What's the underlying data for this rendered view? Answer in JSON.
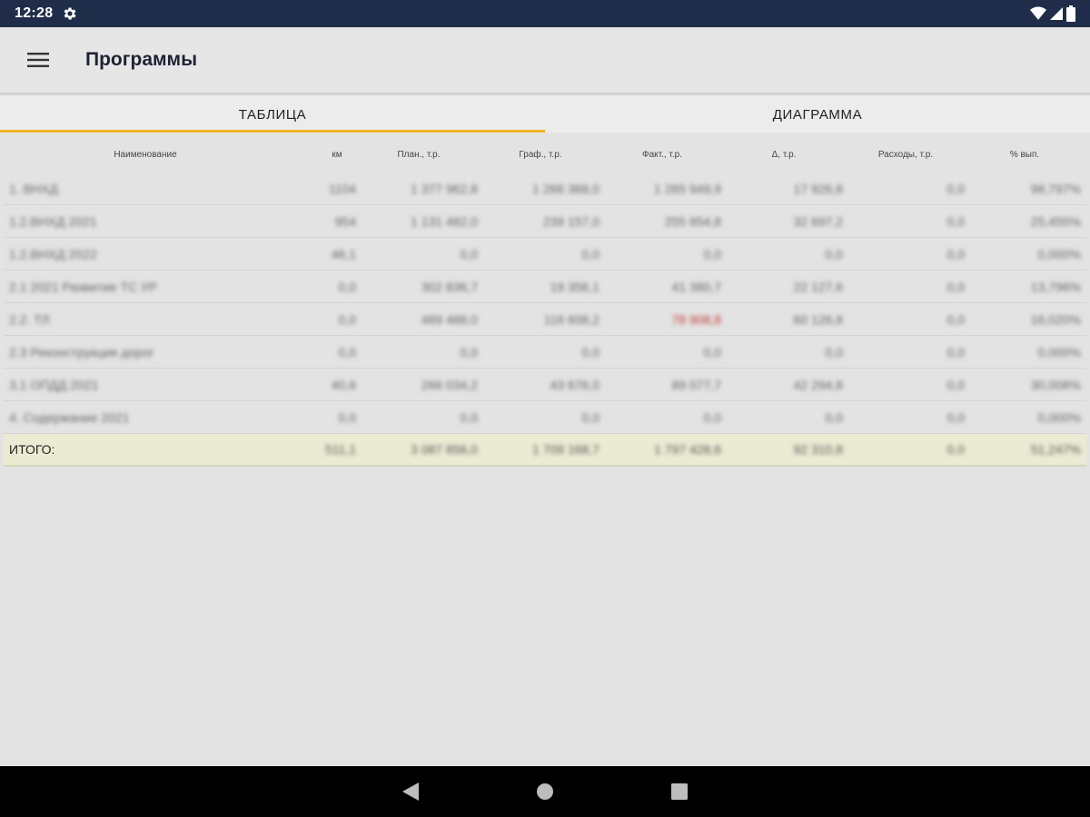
{
  "status_bar": {
    "time": "12:28"
  },
  "app_bar": {
    "title": "Программы"
  },
  "tabs": [
    {
      "label": "ТАБЛИЦА",
      "active": true
    },
    {
      "label": "ДИАГРАММА",
      "active": false
    }
  ],
  "table": {
    "headers": [
      "Наименование",
      "км",
      "План., т.р.",
      "Граф., т.р.",
      "Факт., т.р.",
      "Δ, т.р.",
      "Расходы, т.р.",
      "% вып."
    ],
    "rows": [
      [
        "1. ВНХД",
        "1104",
        "1 377 962,8",
        "1 266 368,0",
        "1 265 949,9",
        "17 926,8",
        "0,0",
        "98,797%"
      ],
      [
        "1.2.ВНХД 2021",
        "954",
        "1 131 482,0",
        "239 157,0",
        "255 854,8",
        "32 697,2",
        "0,0",
        "25,455%"
      ],
      [
        "1.2.ВНХД 2022",
        "46,1",
        "0,0",
        "0,0",
        "0,0",
        "0,0",
        "0,0",
        "0,000%"
      ],
      [
        "2.1 2021 Развитие ТС УР",
        "0,0",
        "302 836,7",
        "19 356,1",
        "41 380,7",
        "22 127,6",
        "0,0",
        "13,796%"
      ],
      [
        "2.2. ТЛ",
        "0,0",
        "489 488,0",
        "116 608,2",
        "78 908,8",
        "60 126,8",
        "0,0",
        "16,020%"
      ],
      [
        "2.3 Реконструкция дорог",
        "0,0",
        "0,0",
        "0,0",
        "0,0",
        "0,0",
        "0,0",
        "0,000%"
      ],
      [
        "3.1 ОПДД 2021",
        "40,6",
        "266 034,2",
        "43 676,0",
        "89 077,7",
        "42 294,8",
        "0,0",
        "30,008%"
      ],
      [
        "4. Содержание 2021",
        "0,0",
        "0,0",
        "0,0",
        "0,0",
        "0,0",
        "0,0",
        "0,000%"
      ]
    ],
    "highlight_cell": {
      "row": 4,
      "col": 4,
      "color": "#c0392b"
    },
    "total": [
      "ИТОГО:",
      "511,1",
      "3 087 856,0",
      "1 709 168,7",
      "1 797 428,6",
      "92 310,8",
      "0,0",
      "51,247%"
    ]
  },
  "icons": {
    "status_gear": "gear-icon",
    "status_wifi": "wifi-icon",
    "status_signal": "signal-icon",
    "status_battery": "battery-icon",
    "menu": "hamburger-menu-icon",
    "nav_back": "back-triangle-icon",
    "nav_home": "home-circle-icon",
    "nav_recents": "recents-square-icon"
  },
  "colors": {
    "status_bar": "#1f2d4a",
    "tab_indicator": "#f0b428",
    "total_row_bg": "#ebebd4",
    "negative_value": "#c0392b"
  }
}
